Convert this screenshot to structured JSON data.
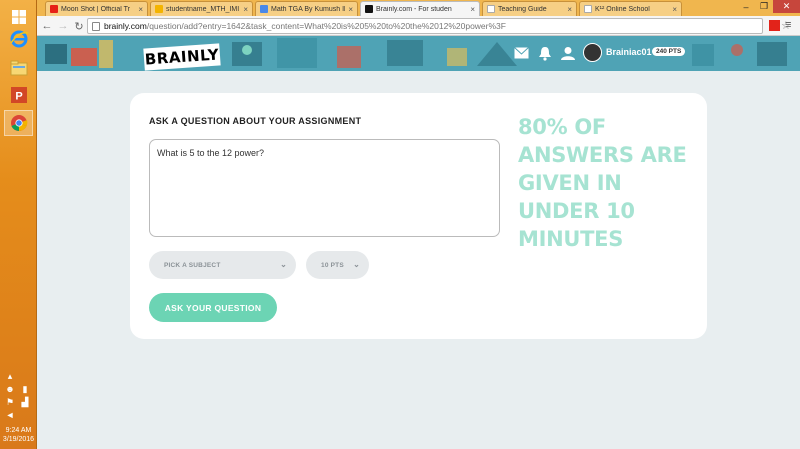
{
  "browser": {
    "tabs": [
      {
        "title": "Moon Shot | Official Tr",
        "color": "#e62117",
        "active": false
      },
      {
        "title": "studentname_MTH_IMI",
        "color": "#f4b400",
        "active": false
      },
      {
        "title": "Math TGA By Kumush Ib",
        "color": "#4a88e8",
        "active": false
      },
      {
        "title": "Brainly.com - For studen",
        "color": "#111111",
        "active": true
      },
      {
        "title": "Teaching Guide",
        "color": "#ffffff",
        "active": false
      },
      {
        "title": "K¹² Online School",
        "color": "#ffffff",
        "active": false
      }
    ],
    "url_domain": "brainly.com",
    "url_path": "/question/add?entry=1642&task_content=What%20is%205%20to%20the%2012%20power%3F"
  },
  "header": {
    "logo": "BRAINLY",
    "username": "Brainiac01",
    "points": "240 PTS"
  },
  "form": {
    "heading": "ASK A QUESTION ABOUT YOUR ASSIGNMENT",
    "question": "What is 5 to the 12 power?",
    "subject_placeholder": "PICK A SUBJECT",
    "points_value": "10 PTS",
    "submit_label": "ASK YOUR QUESTION"
  },
  "promo": {
    "text": "80% OF ANSWERS ARE GIVEN IN UNDER 10 MINUTES"
  },
  "taskbar": {
    "time": "9:24 AM",
    "date": "3/19/2016"
  },
  "colors": {
    "taskbar": "#e58d1b",
    "header": "#4fa3b5",
    "accent": "#6cd4b4",
    "promo": "#a6e3d2"
  }
}
